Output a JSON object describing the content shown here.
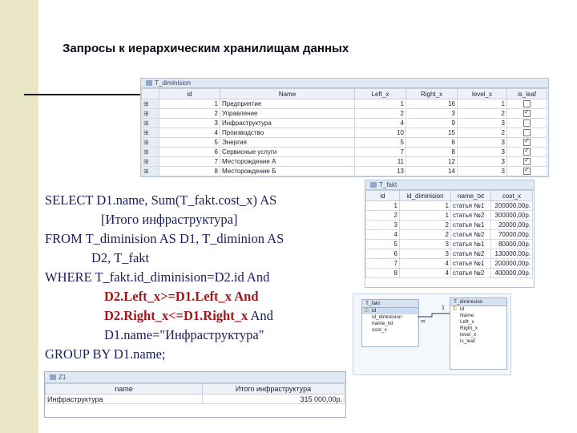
{
  "slide": {
    "title": "Запросы к иерархическим хранилищам данных"
  },
  "tables": {
    "diminision": {
      "tab_title": "T_diminision",
      "headers": [
        "",
        "id",
        "Name",
        "Left_x",
        "Right_x",
        "level_x",
        "is_leaf"
      ],
      "rows": [
        {
          "id": "1",
          "name": "Предприятие",
          "left": "1",
          "right": "16",
          "level": "1",
          "leaf": false
        },
        {
          "id": "2",
          "name": "Управление",
          "left": "2",
          "right": "3",
          "level": "2",
          "leaf": true
        },
        {
          "id": "3",
          "name": "Инфраструктура",
          "left": "4",
          "right": "9",
          "level": "3",
          "leaf": false
        },
        {
          "id": "4",
          "name": "Производство",
          "left": "10",
          "right": "15",
          "level": "2",
          "leaf": false
        },
        {
          "id": "5",
          "name": "Энергия",
          "left": "5",
          "right": "6",
          "level": "3",
          "leaf": true
        },
        {
          "id": "6",
          "name": "Сервисные услуги",
          "left": "7",
          "right": "8",
          "level": "3",
          "leaf": true
        },
        {
          "id": "7",
          "name": "Месторождение А",
          "left": "11",
          "right": "12",
          "level": "3",
          "leaf": true
        },
        {
          "id": "8",
          "name": "Месторождение Б",
          "left": "13",
          "right": "14",
          "level": "3",
          "leaf": true
        }
      ]
    },
    "fakt": {
      "tab_title": "T_fakt",
      "headers": [
        "id",
        "id_diminision",
        "name_txt",
        "cost_x"
      ],
      "rows": [
        {
          "id": "1",
          "dim": "1",
          "name": "статья №1",
          "cost": "200000,00р."
        },
        {
          "id": "2",
          "dim": "1",
          "name": "статья №2",
          "cost": "300000,00р."
        },
        {
          "id": "3",
          "dim": "2",
          "name": "статья №1",
          "cost": "20000,00р."
        },
        {
          "id": "4",
          "dim": "2",
          "name": "статья №2",
          "cost": "70000,00р."
        },
        {
          "id": "5",
          "dim": "3",
          "name": "статья №1",
          "cost": "80000,00р."
        },
        {
          "id": "6",
          "dim": "3",
          "name": "статья №2",
          "cost": "130000,00р."
        },
        {
          "id": "7",
          "dim": "4",
          "name": "статья №1",
          "cost": "200000,00р."
        },
        {
          "id": "8",
          "dim": "4",
          "name": "статья №2",
          "cost": "400000,00р."
        }
      ]
    },
    "result": {
      "tab_title": "Z1",
      "headers": [
        "name",
        "Итого инфраструктура"
      ],
      "rows": [
        {
          "name": "Инфраструктура",
          "total": "315 000,00р."
        }
      ]
    }
  },
  "sql": {
    "lines": [
      "SELECT D1.name, Sum(T_fakt.cost_x) AS",
      "[Итого инфраструктура]",
      "FROM T_diminision AS D1, T_diminion AS",
      "D2, T_fakt",
      "WHERE T_fakt.id_diminision=D2.id And",
      "D2.Left_x>=D1.Left_x And",
      "D2.Right_x<=D1.Right_x",
      "And",
      "D1.name=\"Инфраструктура\"",
      "GROUP BY D1.name;"
    ]
  },
  "relationships": {
    "fakt_box": {
      "title": "T_fakt",
      "fields": [
        "id",
        "id_diminision",
        "name_txt",
        "cost_x"
      ]
    },
    "dim_box": {
      "title": "T_diminision",
      "fields": [
        "id",
        "Name",
        "Left_x",
        "Right_x",
        "level_x",
        "is_leaf"
      ]
    },
    "cardinality_one": "1",
    "cardinality_many": "∞"
  }
}
